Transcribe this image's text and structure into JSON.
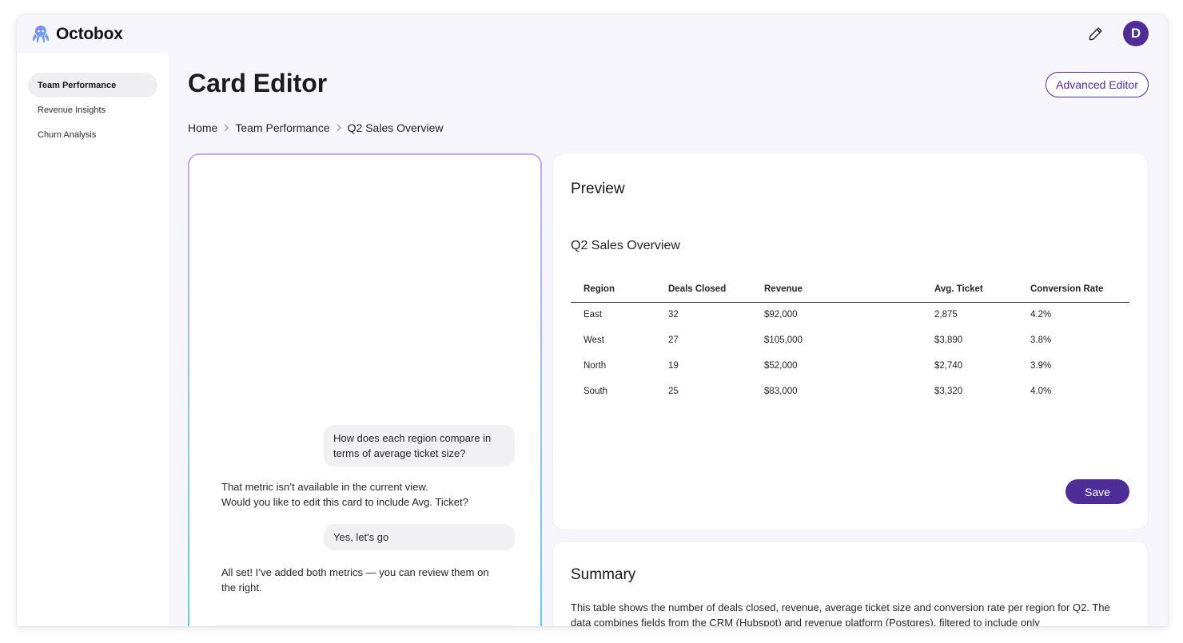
{
  "app": {
    "name": "Octobox",
    "avatar_initial": "D",
    "accent_color": "#4f2d99"
  },
  "icons": {
    "logo": "octopus-logo-icon",
    "edit": "pencil-icon",
    "breadcrumb_separator": "chevron-right-icon"
  },
  "sidebar": {
    "items": [
      {
        "label": "Team Performance",
        "active": true
      },
      {
        "label": "Revenue Insights",
        "active": false
      },
      {
        "label": "Churn Analysis",
        "active": false
      }
    ]
  },
  "header": {
    "title": "Card Editor",
    "advanced_editor_label": "Advanced Editor"
  },
  "breadcrumb": [
    "Home",
    "Team Performance",
    "Q2 Sales Overview"
  ],
  "chat": {
    "messages": [
      {
        "role": "user",
        "text": "How does each region compare in terms of average ticket size?"
      },
      {
        "role": "assistant",
        "lines": [
          "That metric isn’t available in the current view.",
          "Would you like to edit this card to include Avg. Ticket?"
        ]
      },
      {
        "role": "user",
        "text": "Yes, let's go"
      },
      {
        "role": "assistant",
        "text": "All set! I’ve added both metrics — you can review them on the right."
      }
    ]
  },
  "preview": {
    "title": "Preview",
    "card_title": "Q2 Sales Overview",
    "columns": [
      "Region",
      "Deals Closed",
      "Revenue",
      "Avg. Ticket",
      "Conversion Rate"
    ],
    "rows": [
      [
        "East",
        "32",
        "$92,000",
        "2,875",
        "4.2%"
      ],
      [
        "West",
        "27",
        "$105,000",
        "$3,890",
        "3.8%"
      ],
      [
        "North",
        "19",
        "$52,000",
        "$2,740",
        "3.9%"
      ],
      [
        "South",
        "25",
        "$83,000",
        "$3,320",
        "4.0%"
      ]
    ],
    "save_label": "Save"
  },
  "summary": {
    "title": "Summary",
    "text": "This table shows the number of deals closed, revenue, average ticket size and conversion rate per region for Q2. The data combines fields from the CRM (Hubspot) and revenue platform (Postgres), filtered to include only"
  }
}
